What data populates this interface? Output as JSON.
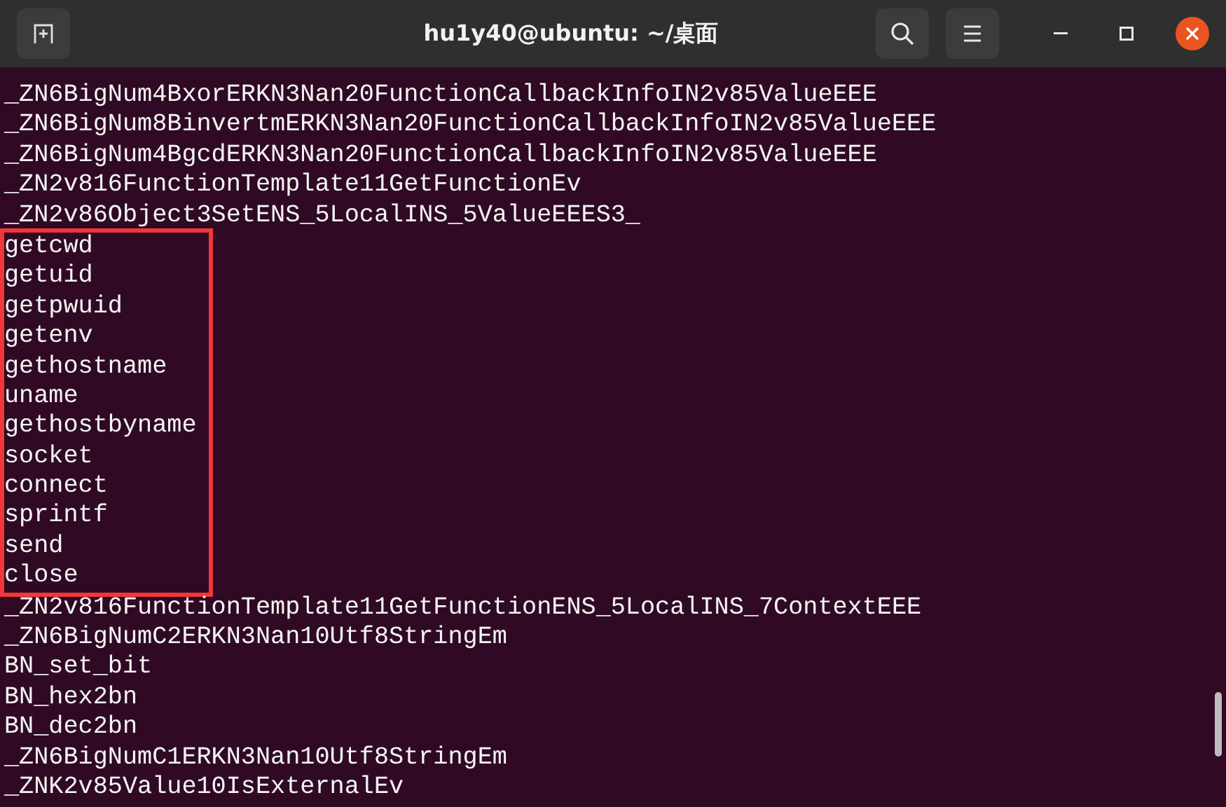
{
  "window": {
    "title": "hu1y40@ubuntu: ~/桌面"
  },
  "output": [
    {
      "highlighted": false,
      "lines": [
        "_ZN6BigNum4BxorERKN3Nan20FunctionCallbackInfoIN2v85ValueEEE",
        "_ZN6BigNum8BinvertmERKN3Nan20FunctionCallbackInfoIN2v85ValueEEE",
        "_ZN6BigNum4BgcdERKN3Nan20FunctionCallbackInfoIN2v85ValueEEE",
        "_ZN2v816FunctionTemplate11GetFunctionEv",
        "_ZN2v86Object3SetENS_5LocalINS_5ValueEEES3_"
      ]
    },
    {
      "highlighted": true,
      "lines": [
        "getcwd",
        "getuid",
        "getpwuid",
        "getenv",
        "gethostname",
        "uname",
        "gethostbyname",
        "socket",
        "connect",
        "sprintf",
        "send",
        "close"
      ]
    },
    {
      "highlighted": false,
      "lines": [
        "_ZN2v816FunctionTemplate11GetFunctionENS_5LocalINS_7ContextEEE",
        "_ZN6BigNumC2ERKN3Nan10Utf8StringEm",
        "BN_set_bit",
        "BN_hex2bn",
        "BN_dec2bn",
        "_ZN6BigNumC1ERKN3Nan10Utf8StringEm",
        "_ZNK2v85Value10IsExternalEv"
      ]
    }
  ]
}
